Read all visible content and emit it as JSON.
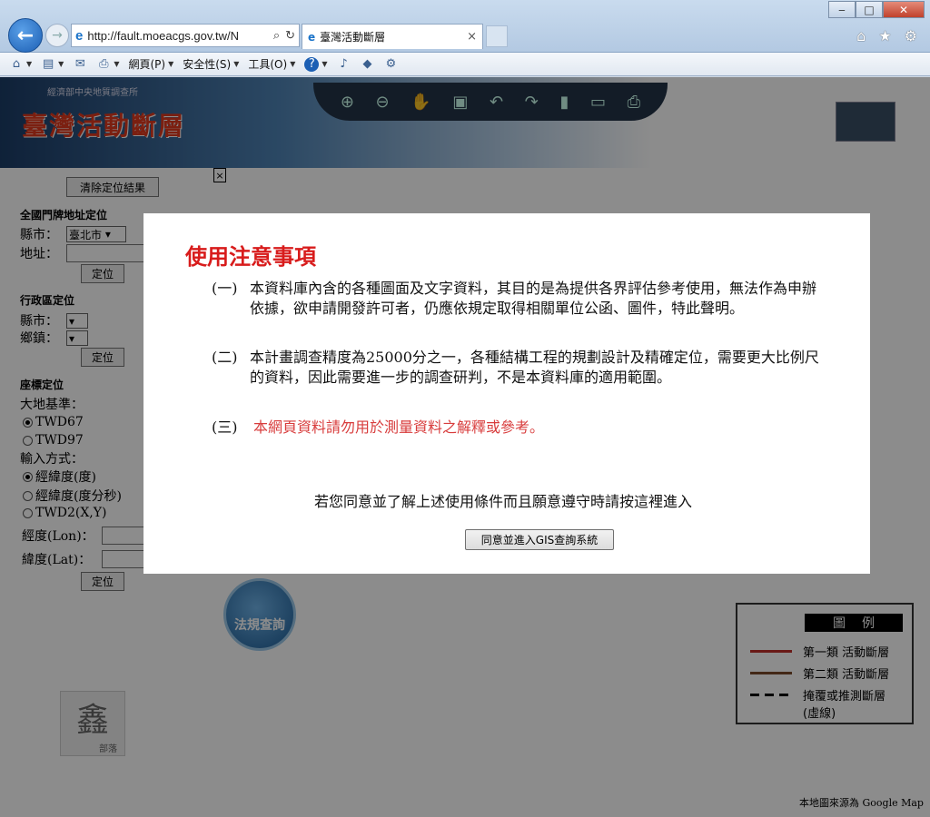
{
  "browser": {
    "url": "http://fault.moeacgs.gov.tw/N",
    "tab_title": "臺灣活動斷層",
    "menus": {
      "page": "網頁(P)",
      "safety": "安全性(S)",
      "tools": "工具(O)"
    }
  },
  "page": {
    "banner_title": "臺灣活動斷層",
    "banner_org": "經濟部中央地質調查所",
    "sidebar": {
      "clear_button": "清除定位結果",
      "address_section": "全國門牌地址定位",
      "county_label": "縣市：",
      "county_value": "臺北市",
      "address_label": "地址：",
      "locate_label": "定位",
      "admin_section": "行政區定位",
      "admin_county_label": "縣市：",
      "admin_town_label": "鄉鎮：",
      "coord_section": "座標定位",
      "datum_label": "大地基準：",
      "datum_options": [
        "TWD67",
        "TWD97"
      ],
      "input_label": "輸入方式：",
      "input_options": [
        "經緯度(度)",
        "經緯度(度分秒)",
        "TWD2(X,Y)"
      ],
      "lon_label": "經度(Lon)：",
      "lat_label": "緯度(Lat)："
    },
    "law_button": "法規查詢",
    "stamp": {
      "char": "鑫",
      "sub": "部落"
    },
    "legend": {
      "title": "圖例",
      "rows": [
        {
          "label": "第一類 活動斷層",
          "color": "#c0302a"
        },
        {
          "label": "第二類 活動斷層",
          "color": "#7a4a2a"
        },
        {
          "label": "掩覆或推測斷層",
          "sub": "(虛線)",
          "color": "#000000"
        }
      ]
    },
    "map_source": "本地圖來源為 Google Map"
  },
  "modal": {
    "title": "使用注意事項",
    "items": [
      {
        "num": "(一)",
        "text": "本資料庫內含的各種圖面及文字資料，其目的是為提供各界評估參考使用，無法作為申辦依據，欲申請開發許可者，仍應依規定取得相關單位公函、圖件，特此聲明。"
      },
      {
        "num": "(二)",
        "text": "本計畫調查精度為25000分之一，各種結構工程的規劃設計及精確定位，需要更大比例尺的資料，因此需要進一步的調查研判，不是本資料庫的適用範圍。"
      },
      {
        "num": "(三)",
        "text": "本網頁資料請勿用於測量資料之解釋或參考。"
      }
    ],
    "prompt": "若您同意並了解上述使用條件而且願意遵守時請按這裡進入",
    "agree_button": "同意並進入GIS查詢系統"
  },
  "colors": {
    "modal_title": "#d81c1c",
    "warning_text": "#d83c3c"
  }
}
